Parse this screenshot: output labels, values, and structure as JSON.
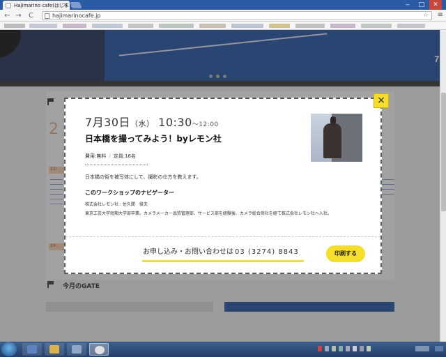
{
  "browser": {
    "tab_title": "Hajimarino cafe(はじま",
    "tab_close": "×",
    "url": "hajimarinocafe.jp",
    "back": "←",
    "forward": "→",
    "reload": "C",
    "bookmark_star": "☆",
    "menu": "≡",
    "minimize": "‒",
    "maximize": "□",
    "close": "✕"
  },
  "hero": {
    "date_fragment": "7."
  },
  "page_bg": {
    "time_chip_1": "11:",
    "time_chip_2": "14:",
    "big_digit": "2",
    "section_heading": "今月のGATE"
  },
  "modal": {
    "date": {
      "month_day": "7月30日",
      "weekday": "（水）",
      "start_time": "10:30",
      "end_time": "〜12:00"
    },
    "title": "日本橋を撮ってみよう！byレモン社",
    "fee": "費用:無料",
    "separator": "/",
    "capacity": "定員:16名",
    "description": "日本橋の街を被写体にして、撮影の仕方を教えます。",
    "navigator_heading": "このワークショップのナビゲーター",
    "navigator_name": "株式会社レモン社 : 佐久間　俊夫",
    "navigator_bio": "東京工芸大学短期大学部卒業。カメラメーカー品質管理部、サービス部を経験後、カメラ総合商社を経て株式会社レモン社へ入社。",
    "contact_label": "お申し込み・お問い合わせは",
    "contact_tel": "03 (3274) 8843",
    "print_button": "印刷する",
    "close_button": "×"
  },
  "colors": {
    "accent_yellow": "#f5df2a",
    "hero_blue": "#1b4f9f",
    "chip_orange": "#f0c9a8"
  }
}
